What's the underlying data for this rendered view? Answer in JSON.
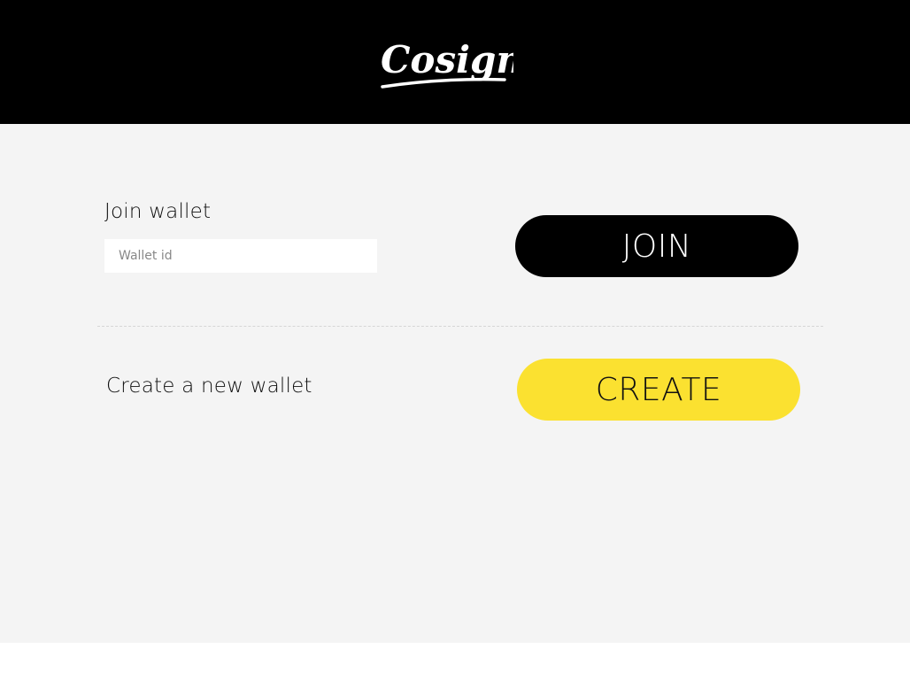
{
  "header": {
    "logo_text": "Cosign",
    "background": "#000000"
  },
  "join": {
    "label": "Join wallet",
    "input_placeholder": "Wallet id",
    "input_value": "",
    "button_label": "JOIN"
  },
  "create": {
    "label": "Create a new wallet",
    "button_label": "CREATE",
    "button_color": "#fbe130"
  },
  "colors": {
    "main_background": "#f4f4f4",
    "accent": "#fbe130"
  }
}
